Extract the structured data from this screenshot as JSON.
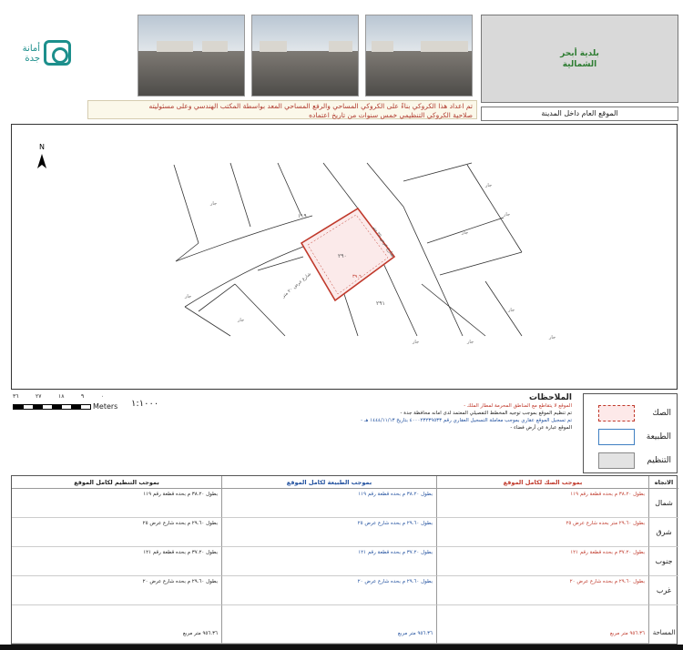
{
  "header": {
    "logo_text": "أمانة جدة",
    "municipality_lines": [
      "بلدية أبحر",
      "الشمالية"
    ],
    "notice_lines": [
      "تم اعداد هذا الكروكي بناءً على الكروكي المساحي والرفع المساحي المعد بواسطة المكتب الهندسي وعلى مسئوليته",
      "صلاحية الكروكي التنظيمي خمس سنوات من تاريخ اعتماده"
    ],
    "location_label": "الموقع العام داخل المدينة"
  },
  "map": {
    "north_label": "N",
    "plot_number": "٢٩٠",
    "plot_side_label": "٣٩.٦٠",
    "neighbor_plots": [
      "١١٩",
      "٢٩١"
    ],
    "street_label_north": "شارع عرض ٢٥ متر",
    "street_label_south": "شارع عرض ٢٠ متر",
    "neighbor_text": "جار",
    "deed_color": "#c0392b",
    "line_color": "#333333"
  },
  "scale": {
    "ticks": [
      "٣٦",
      "٢٧",
      "١٨",
      "٩",
      "٠"
    ],
    "unit": "Meters",
    "ratio": "١:١٠٠٠"
  },
  "notes": {
    "title": "الملاحظات",
    "lines": [
      "- الموقع لا يتقاطع مع المناطق المحرمة لمطار الملك",
      "- تم تنظيم الموقع بموجب توجيه المخطط التفصيلي المعتمد لدى امانه محافظة جدة",
      "- تم تسجيل الموقع عقاري بموجب معاملة التسجيل العقاري رقم ٤٠٠٠٢٣٢٣٩٥٣٣ بتاريخ ١٤٤٤/١١/١٣ هـ",
      "- الموقع عبارة عن أرض فضاء"
    ]
  },
  "legend": {
    "items": [
      "الصك",
      "الطبيعة",
      "التنظيم"
    ]
  },
  "table": {
    "headers": {
      "direction": "الاتجاه",
      "deed": "بموجب الصك لكامل الموقع",
      "nature": "بموجب الطبيعة لكامل الموقع",
      "plan": "بموجب التنظيم لكامل الموقع"
    },
    "rows": [
      {
        "direction": "شمال",
        "deed": "بطول ٣٨.٢٠ م بحده قطعة رقم ١١٩",
        "nature": "بطول ٣٨.٢٠ م بحده قطعة رقم ١١٩",
        "plan": "بطول ٣٨.٢٠ م بحده قطعة رقم ١١٩"
      },
      {
        "direction": "شرق",
        "deed": "بطول ٢٩.٦٠ متر بحده شارع عرض ٢٥",
        "nature": "بطول ٢٩.٦٠ م بحده شارع عرض ٢٥",
        "plan": "بطول ٢٩.٦٠ م بحده شارع عرض ٢٥"
      },
      {
        "direction": "جنوب",
        "deed": "بطول ٣٧.٢٠ م بحده قطعة رقم ١٢١",
        "nature": "بطول ٣٧.٢٠ م بحده قطعة رقم ١٢١",
        "plan": "بطول ٣٧.٢٠ م بحده قطعة رقم ١٢١"
      },
      {
        "direction": "غرب",
        "deed": "بطول ٢٩.٦٠ م بحده شارع عرض ٢٠",
        "nature": "بطول ٢٩.٦٠ م بحده شارع عرض ٢٠",
        "plan": "بطول ٢٩.٦٠ م بحده شارع عرض ٢٠"
      }
    ],
    "area_label": "المساحة",
    "areas": {
      "deed": "٩٥٦.٣٦ متر مربع",
      "nature": "٩٥٦.٣٦ متر مربع",
      "plan": "٩٥٦.٣٦ متر مربع"
    }
  }
}
